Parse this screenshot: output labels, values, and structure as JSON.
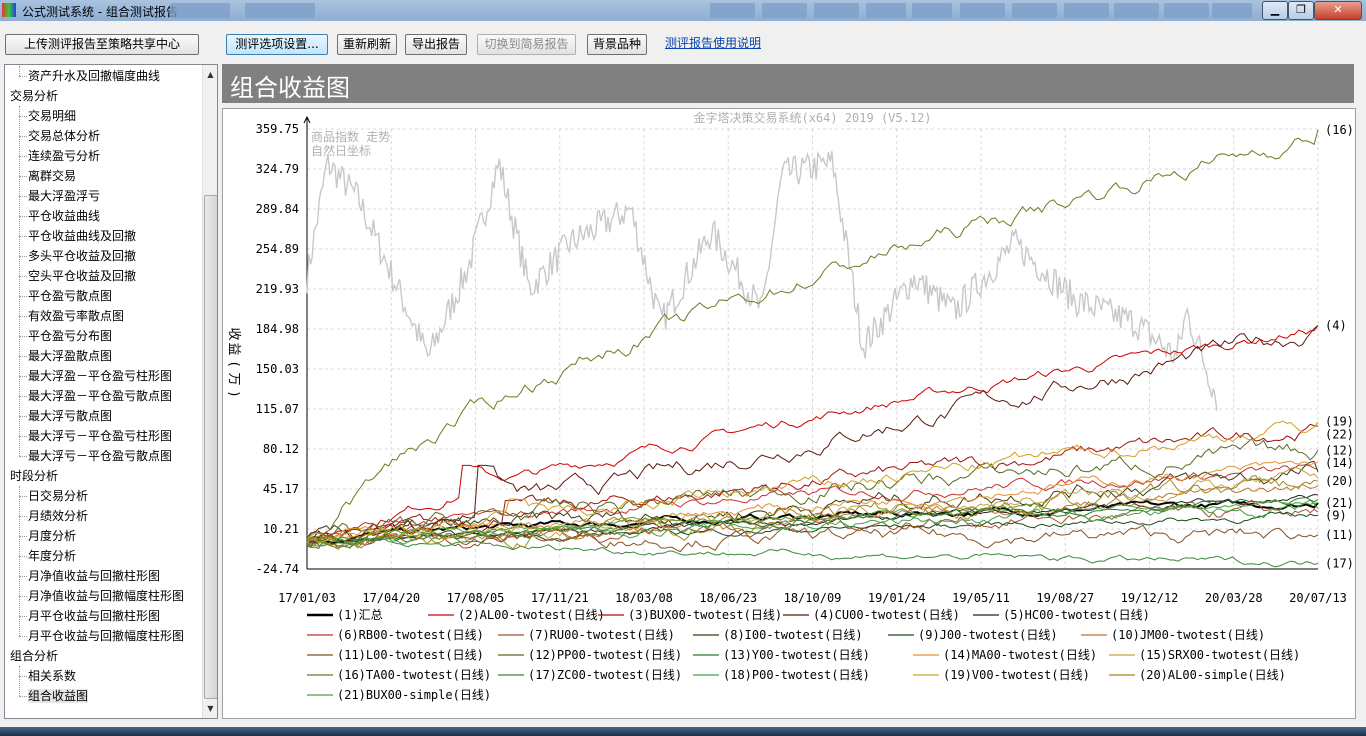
{
  "window": {
    "title": "公式测试系统 - 组合测试报告",
    "minimize_icon": "minimize-icon",
    "maximize_icon": "maximize-icon",
    "close_icon": "close-icon"
  },
  "toolbar": {
    "upload_label": "上传测评报告至策略共享中心",
    "options_label": "测评选项设置...",
    "refresh_label": "重新刷新",
    "export_label": "导出报告",
    "simple_label": "切换到简易报告",
    "bg_label": "背景品种",
    "help_link": "测评报告使用说明"
  },
  "sidebar": {
    "items": [
      {
        "label": "资产升水及回撤幅度曲线",
        "level": 1
      },
      {
        "label": "交易分析",
        "level": 0
      },
      {
        "label": "交易明细",
        "level": 1
      },
      {
        "label": "交易总体分析",
        "level": 1
      },
      {
        "label": "连续盈亏分析",
        "level": 1
      },
      {
        "label": "离群交易",
        "level": 1
      },
      {
        "label": "最大浮盈浮亏",
        "level": 1
      },
      {
        "label": "平仓收益曲线",
        "level": 1
      },
      {
        "label": "平仓收益曲线及回撤",
        "level": 1
      },
      {
        "label": "多头平仓收益及回撤",
        "level": 1
      },
      {
        "label": "空头平仓收益及回撤",
        "level": 1
      },
      {
        "label": "平仓盈亏散点图",
        "level": 1
      },
      {
        "label": "有效盈亏率散点图",
        "level": 1
      },
      {
        "label": "平仓盈亏分布图",
        "level": 1
      },
      {
        "label": "最大浮盈散点图",
        "level": 1
      },
      {
        "label": "最大浮盈－平仓盈亏柱形图",
        "level": 1
      },
      {
        "label": "最大浮盈－平仓盈亏散点图",
        "level": 1
      },
      {
        "label": "最大浮亏散点图",
        "level": 1
      },
      {
        "label": "最大浮亏－平仓盈亏柱形图",
        "level": 1
      },
      {
        "label": "最大浮亏－平仓盈亏散点图",
        "level": 1
      },
      {
        "label": "时段分析",
        "level": 0
      },
      {
        "label": "日交易分析",
        "level": 1
      },
      {
        "label": "月绩效分析",
        "level": 1
      },
      {
        "label": "月度分析",
        "level": 1
      },
      {
        "label": "年度分析",
        "level": 1
      },
      {
        "label": "月净值收益与回撤柱形图",
        "level": 1
      },
      {
        "label": "月净值收益与回撤幅度柱形图",
        "level": 1
      },
      {
        "label": "月平仓收益与回撤柱形图",
        "level": 1
      },
      {
        "label": "月平仓收益与回撤幅度柱形图",
        "level": 1
      },
      {
        "label": "组合分析",
        "level": 0
      },
      {
        "label": "相关系数",
        "level": 1
      },
      {
        "label": "组合收益图",
        "level": 1,
        "selected": true
      }
    ]
  },
  "main": {
    "title": "组合收益图"
  },
  "chart_data": {
    "type": "line",
    "title": "金字塔决策交易系统(x64) 2019 (V5.12)",
    "background_note": "商品指数 走势",
    "background_note2": "自然日坐标",
    "ylabel": "收益(万)",
    "ylim": [
      -24.74,
      359.75
    ],
    "y_ticks": [
      "359.75",
      "324.79",
      "289.84",
      "254.89",
      "219.93",
      "184.98",
      "150.03",
      "115.07",
      "80.12",
      "45.17",
      "10.21",
      "-24.74"
    ],
    "x_ticks": [
      "17/01/03",
      "17/04/20",
      "17/08/05",
      "17/11/21",
      "18/03/08",
      "18/06/23",
      "18/10/09",
      "19/01/24",
      "19/05/11",
      "19/08/27",
      "19/12/12",
      "20/03/28",
      "20/07/13"
    ],
    "grid": true,
    "legend_position": "bottom",
    "right_labels": [
      {
        "text": "(16)",
        "y": 359
      },
      {
        "text": "(4)",
        "y": 188
      },
      {
        "text": "(19)",
        "y": 104
      },
      {
        "text": "(22)",
        "y": 93
      },
      {
        "text": "(12)",
        "y": 79
      },
      {
        "text": "(14)",
        "y": 68
      },
      {
        "text": "(20)",
        "y": 52
      },
      {
        "text": "(21)",
        "y": 33
      },
      {
        "text": "(9)",
        "y": 22
      },
      {
        "text": "(11)",
        "y": 5
      },
      {
        "text": "(17)",
        "y": -20
      }
    ],
    "background_series": {
      "name": "商品指数",
      "color": "#c8c8c8"
    },
    "series": [
      {
        "name": "(1)汇总",
        "color": "#000000",
        "end": 33
      },
      {
        "name": "(2)AL00-twotest(日线)",
        "color": "#cc0000",
        "end": 188
      },
      {
        "name": "(3)BUX00-twotest(日线)",
        "color": "#a01010",
        "end": 100
      },
      {
        "name": "(4)CU00-twotest(日线)",
        "color": "#5a1a10",
        "end": 188
      },
      {
        "name": "(5)HC00-twotest(日线)",
        "color": "#202020",
        "end": 40
      },
      {
        "name": "(6)RB00-twotest(日线)",
        "color": "#c83030",
        "end": 62
      },
      {
        "name": "(7)RU00-twotest(日线)",
        "color": "#a05030",
        "end": 25
      },
      {
        "name": "(8)I00-twotest(日线)",
        "color": "#3a3a10",
        "end": 60
      },
      {
        "name": "(9)J00-twotest(日线)",
        "color": "#1c4a1c",
        "end": 22
      },
      {
        "name": "(10)JM00-twotest(日线)",
        "color": "#c07030",
        "end": 48
      },
      {
        "name": "(11)L00-twotest(日线)",
        "color": "#8a5020",
        "end": 5
      },
      {
        "name": "(12)PP00-twotest(日线)",
        "color": "#5a6a20",
        "end": 79
      },
      {
        "name": "(13)Y00-twotest(日线)",
        "color": "#2a7a2a",
        "end": 36
      },
      {
        "name": "(14)MA00-twotest(日线)",
        "color": "#e09030",
        "end": 68
      },
      {
        "name": "(15)SRX00-twotest(日线)",
        "color": "#c8a040",
        "end": 55
      },
      {
        "name": "(16)TA00-twotest(日线)",
        "color": "#6a7a20",
        "end": 359
      },
      {
        "name": "(17)ZC00-twotest(日线)",
        "color": "#3a8a3a",
        "end": -20
      },
      {
        "name": "(18)P00-twotest(日线)",
        "color": "#40a040",
        "end": 28
      },
      {
        "name": "(19)V00-twotest(日线)",
        "color": "#d0a020",
        "end": 104
      },
      {
        "name": "(20)AL00-simple(日线)",
        "color": "#a08820",
        "end": 52
      },
      {
        "name": "(21)BUX00-simple(日线)",
        "color": "#50a030",
        "end": 33
      }
    ]
  }
}
